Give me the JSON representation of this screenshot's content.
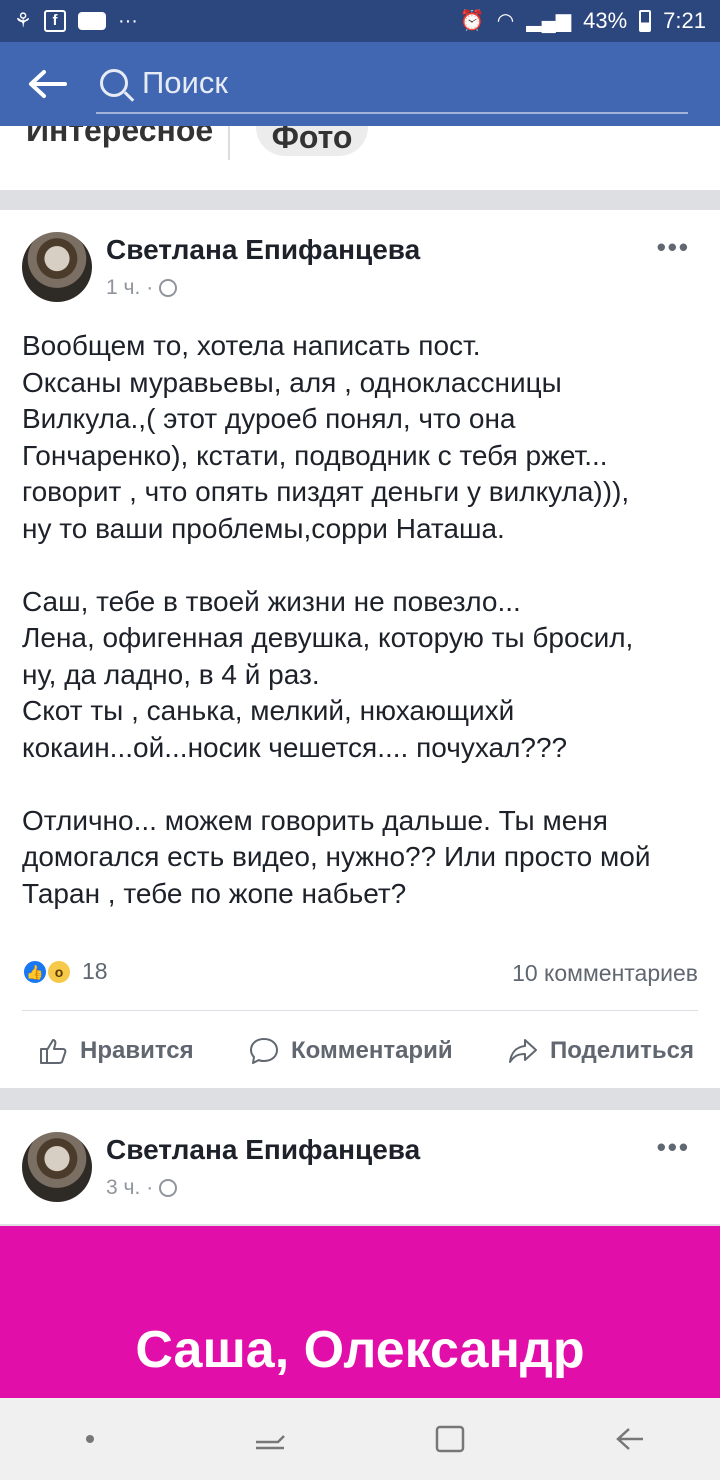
{
  "status_bar": {
    "battery": "43%",
    "time": "7:21"
  },
  "search": {
    "placeholder": "Поиск"
  },
  "tabs": {
    "interesting": "Интересное",
    "photo": "Фото"
  },
  "posts": [
    {
      "author": "Светлана Епифанцева",
      "time": "1 ч.",
      "text_lines": [
        "Вообщем то, хотела написать пост.",
        "Оксаны муравьевы, аля , одноклассницы",
        "Вилкула.,( этот дуроеб понял, что она",
        "Гончаренко), кстати, подводник с тебя ржет...",
        "говорит , что опять пиздят деньги у вилкула))),",
        "ну то ваши проблемы,сорри Наташа.",
        "",
        "Саш, тебе в твоей жизни не повезло...",
        "Лена, офигенная девушка, которую ты бросил,",
        "ну, да ладно, в 4 й раз.",
        "Скот ты , санька, мелкий, нюхающихй",
        "кокаин...ой...носик чешется.... почухал???",
        "",
        "Отлично... можем говорить дальше. Ты меня",
        "домогался  есть видео, нужно?? Или просто мой",
        "Таран , тебе по жопе набьет?"
      ],
      "reactions_count": "18",
      "comments": "10 комментариев",
      "actions": {
        "like": "Нравится",
        "comment": "Комментарий",
        "share": "Поделиться"
      }
    },
    {
      "author": "Светлана Епифанцева",
      "time": "3 ч.",
      "banner_text": "Саша, Олександр"
    }
  ],
  "colors": {
    "facebook_blue": "#4267b2",
    "banner_magenta": "#e20ea9"
  }
}
